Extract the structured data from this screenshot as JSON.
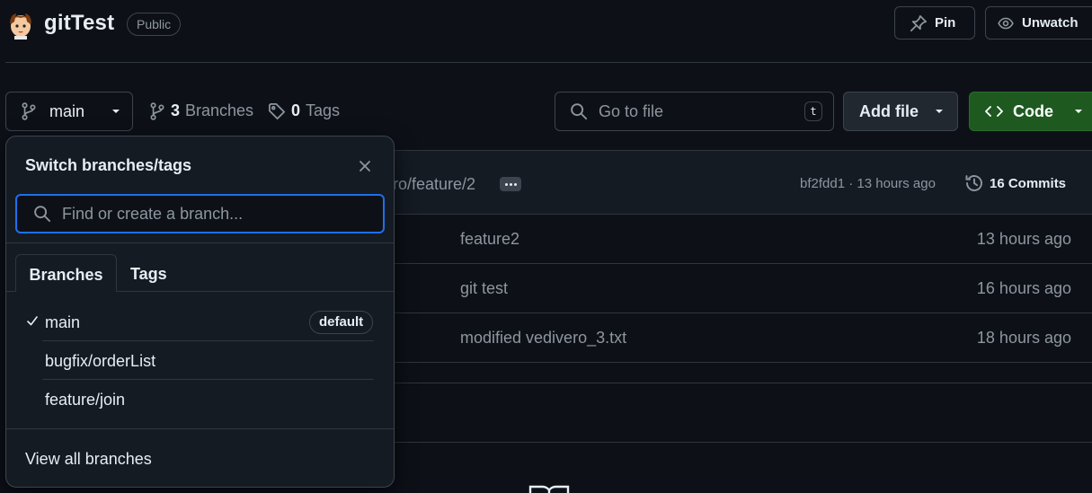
{
  "repo": {
    "name": "gitTest",
    "visibility": "Public"
  },
  "header": {
    "pin_label": "Pin",
    "unwatch_label": "Unwatch"
  },
  "branch_bar": {
    "current_branch": "main",
    "branches_count": "3",
    "branches_label": "Branches",
    "tags_count": "0",
    "tags_label": "Tags"
  },
  "goto_file": {
    "placeholder": "Go to file",
    "shortcut": "t"
  },
  "add_file_label": "Add file",
  "code_label": "Code",
  "latest_commit": {
    "message_fragment": "ro/feature/2",
    "hash_and_time": "bf2fdd1 · 13 hours ago",
    "commits_count_label": "16 Commits"
  },
  "files": [
    {
      "message": "feature2",
      "age": "13 hours ago"
    },
    {
      "message": "git test",
      "age": "16 hours ago"
    },
    {
      "message": "modified vedivero_3.txt",
      "age": "18 hours ago"
    }
  ],
  "branch_dropdown": {
    "title": "Switch branches/tags",
    "search_placeholder": "Find or create a branch...",
    "tabs": [
      "Branches",
      "Tags"
    ],
    "branches": [
      {
        "name": "main",
        "selected": true,
        "badge": "default"
      },
      {
        "name": "bugfix/orderList",
        "selected": false
      },
      {
        "name": "feature/join",
        "selected": false
      }
    ],
    "view_all_label": "View all branches"
  },
  "colors": {
    "background": "#0d1117",
    "border": "#30363d",
    "code_button": "#1e5a20",
    "focus_ring": "#1f6feb",
    "muted_text": "#8d96a0"
  }
}
